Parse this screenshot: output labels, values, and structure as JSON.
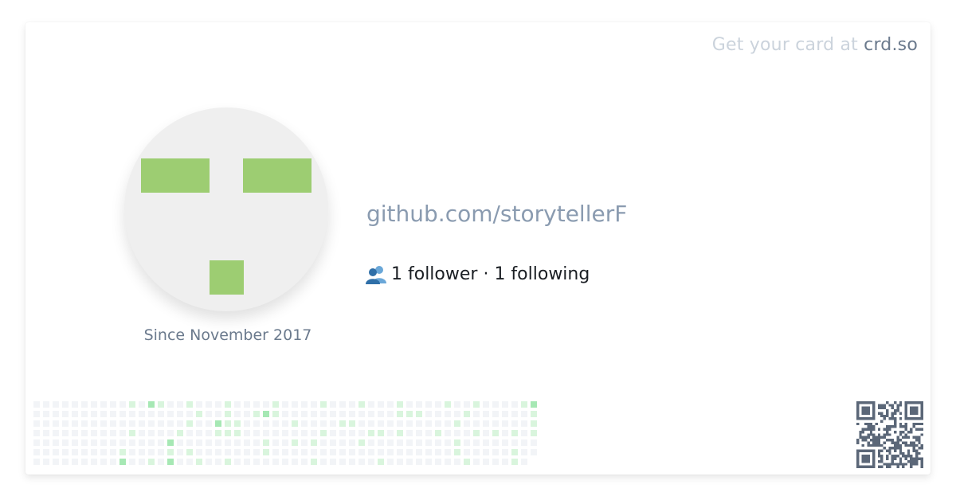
{
  "promo": {
    "text": "Get your card at ",
    "link": "crd.so"
  },
  "profile": {
    "since": "Since November 2017",
    "handle": "github.com/storytellerF",
    "followers_text": "1 follower",
    "separator": " · ",
    "following_text": "1 following",
    "social_icon": "people-icon"
  },
  "avatar": {
    "type": "identicon",
    "color": "#9dcd72",
    "background": "#efefef"
  },
  "contributions": {
    "weeks": 53,
    "days": 7,
    "colors": [
      "#f2f4f7",
      "#d9f5dd",
      "#a6e8b4",
      "#5bd27c"
    ],
    "active": [
      [
        10,
        0,
        1
      ],
      [
        12,
        0,
        2
      ],
      [
        13,
        0,
        1
      ],
      [
        16,
        0,
        1
      ],
      [
        20,
        0,
        1
      ],
      [
        25,
        0,
        1
      ],
      [
        30,
        0,
        1
      ],
      [
        34,
        0,
        1
      ],
      [
        38,
        0,
        1
      ],
      [
        43,
        0,
        1
      ],
      [
        46,
        0,
        1
      ],
      [
        51,
        0,
        1
      ],
      [
        52,
        0,
        2
      ],
      [
        17,
        1,
        1
      ],
      [
        20,
        1,
        1
      ],
      [
        23,
        1,
        1
      ],
      [
        24,
        1,
        2
      ],
      [
        25,
        1,
        1
      ],
      [
        38,
        1,
        1
      ],
      [
        39,
        1,
        1
      ],
      [
        40,
        1,
        1
      ],
      [
        45,
        1,
        1
      ],
      [
        52,
        1,
        1
      ],
      [
        16,
        2,
        1
      ],
      [
        19,
        2,
        2
      ],
      [
        20,
        2,
        1
      ],
      [
        21,
        2,
        1
      ],
      [
        27,
        2,
        1
      ],
      [
        32,
        2,
        1
      ],
      [
        33,
        2,
        1
      ],
      [
        44,
        2,
        1
      ],
      [
        52,
        2,
        1
      ],
      [
        10,
        3,
        1
      ],
      [
        15,
        3,
        1
      ],
      [
        19,
        3,
        1
      ],
      [
        20,
        3,
        1
      ],
      [
        21,
        3,
        1
      ],
      [
        30,
        3,
        1
      ],
      [
        35,
        3,
        1
      ],
      [
        36,
        3,
        1
      ],
      [
        38,
        3,
        1
      ],
      [
        42,
        3,
        1
      ],
      [
        46,
        3,
        1
      ],
      [
        48,
        3,
        1
      ],
      [
        50,
        3,
        1
      ],
      [
        52,
        3,
        1
      ],
      [
        14,
        4,
        2
      ],
      [
        24,
        4,
        1
      ],
      [
        27,
        4,
        1
      ],
      [
        29,
        4,
        1
      ],
      [
        34,
        4,
        1
      ],
      [
        44,
        4,
        1
      ],
      [
        9,
        5,
        1
      ],
      [
        14,
        5,
        1
      ],
      [
        16,
        5,
        1
      ],
      [
        24,
        5,
        1
      ],
      [
        44,
        5,
        1
      ],
      [
        50,
        5,
        1
      ],
      [
        9,
        6,
        2
      ],
      [
        12,
        6,
        1
      ],
      [
        14,
        6,
        2
      ],
      [
        17,
        6,
        1
      ],
      [
        20,
        6,
        1
      ],
      [
        29,
        6,
        1
      ],
      [
        36,
        6,
        1
      ],
      [
        45,
        6,
        1
      ],
      [
        50,
        6,
        1
      ]
    ]
  },
  "qr": {
    "fill": "#5b6778"
  }
}
